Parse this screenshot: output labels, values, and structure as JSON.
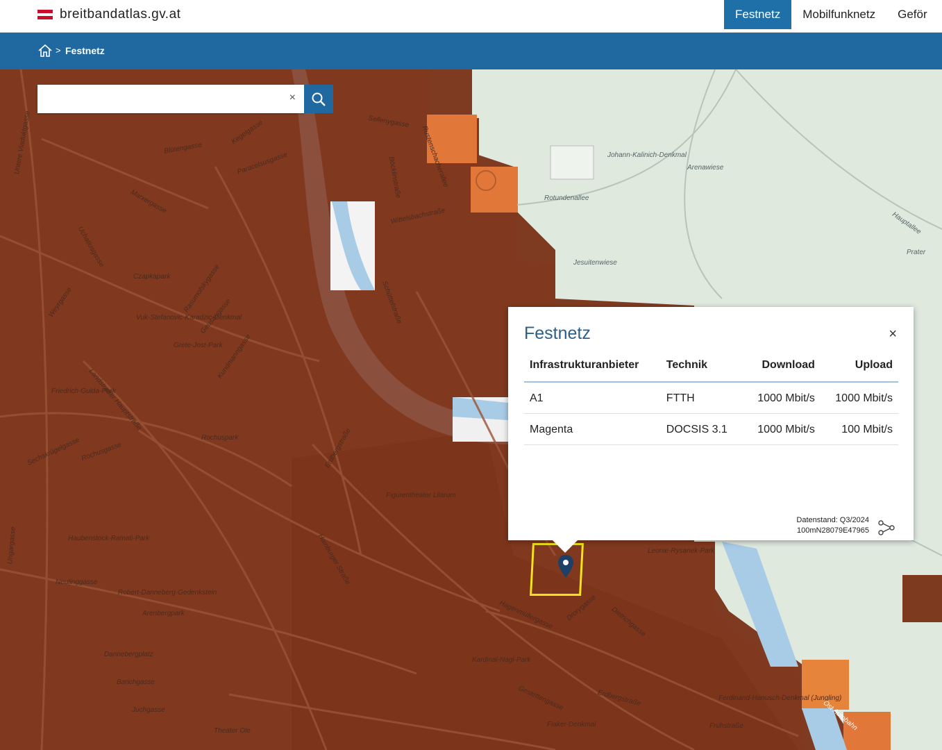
{
  "header": {
    "site_name": "breitbandatlas.gv.at",
    "nav": [
      "Festnetz",
      "Mobilfunknetz",
      "Geför"
    ],
    "active_nav": "Festnetz"
  },
  "breadcrumb": {
    "current": "Festnetz",
    "separator": ">"
  },
  "search": {
    "value": "",
    "clear_label": "×"
  },
  "map": {
    "labels": [
      "Johann-Kalinich-Denkmal",
      "Arenawiese",
      "Rotundenallee",
      "Hauptallee",
      "Prater",
      "Jesuitenwiese",
      "Schüttelstraße",
      "Wittelsbachstraße",
      "Böcklinstraße",
      "Rustenschacherallee",
      "Sellenygasse",
      "Czapkapark",
      "Rasumofskygasse",
      "Landstraßer Hauptstraße",
      "Rochuspark",
      "Erdbergstraße",
      "Figurentheater Lilarum",
      "Hainburger Straße",
      "Kegelgasse",
      "Paracelsusgasse",
      "Marxergasse",
      "Weyrgasse",
      "Ungargasse",
      "Neulinggasse",
      "Arenbergpark",
      "Dannebergplatz",
      "Barichgasse",
      "Juchgasse",
      "Hagenmüllergasse",
      "Dietrichgasse",
      "Leonie-Rysanek-Park",
      "Ferdinand-Hanusch-Denkmal (Jungling)",
      "Frühstraße",
      "Ost Autobahn",
      "Kardinal-Nagl-Park",
      "Fiaker-Denkmal",
      "Theater Ole",
      "Haubenstock-Ramati-Park",
      "Robert-Danneberg-Gedenkstein",
      "Grete-Jost-Park",
      "Friedrich-Gulda-Park",
      "Vuk-Stefanovic-Karadzic-Denkmal",
      "Gestettengasse",
      "Drorygasse",
      "Erdbergstraße",
      "Kundmanngasse",
      "Geusaugasse",
      "Sechskrügelgasse",
      "Rochusgasse",
      "Uchatiusgasse",
      "Blütengasse",
      "Untere Viaduktgasse"
    ]
  },
  "popup": {
    "title": "Festnetz",
    "close": "×",
    "headers": [
      "Infrastrukturanbieter",
      "Technik",
      "Download",
      "Upload"
    ],
    "rows": [
      [
        "A1",
        "FTTH",
        "1000 Mbit/s",
        "1000 Mbit/s"
      ],
      [
        "Magenta",
        "DOCSIS 3.1",
        "1000 Mbit/s",
        "100 Mbit/s"
      ]
    ],
    "datenstand": "Datenstand: Q3/2024",
    "cell_id": "100mN28079E47965"
  },
  "colors": {
    "accent": "#2068a0",
    "coverage": "#7f3b21",
    "coverage_orange": "#e6793b",
    "park": "#dde8dc",
    "water": "#a8cbe6",
    "selection": "#f4e21b"
  }
}
